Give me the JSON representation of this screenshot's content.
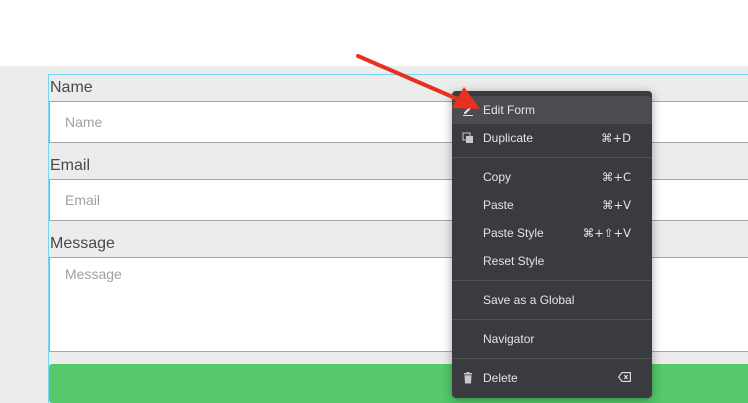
{
  "form": {
    "fields": [
      {
        "label": "Name",
        "placeholder": "Name"
      },
      {
        "label": "Email",
        "placeholder": "Email"
      },
      {
        "label": "Message",
        "placeholder": "Message"
      }
    ]
  },
  "context_menu": {
    "items": [
      {
        "label": "Edit Form",
        "shortcut": "",
        "icon": "pencil-icon",
        "highlighted": true
      },
      {
        "label": "Duplicate",
        "shortcut": "⌘+D",
        "icon": "duplicate-icon"
      },
      {
        "label": "Copy",
        "shortcut": "⌘+C"
      },
      {
        "label": "Paste",
        "shortcut": "⌘+V"
      },
      {
        "label": "Paste Style",
        "shortcut": "⌘+⇧+V"
      },
      {
        "label": "Reset Style",
        "shortcut": ""
      },
      {
        "label": "Save as a Global",
        "shortcut": ""
      },
      {
        "label": "Navigator",
        "shortcut": ""
      },
      {
        "label": "Delete",
        "shortcut": "",
        "icon": "trash-icon",
        "shortcut_icon": "delete-key-icon"
      }
    ]
  },
  "colors": {
    "menu_bg": "#3a3b3e",
    "submit": "#55c96b",
    "arrow": "#e8301f",
    "selection_outline": "#71d7f7"
  }
}
